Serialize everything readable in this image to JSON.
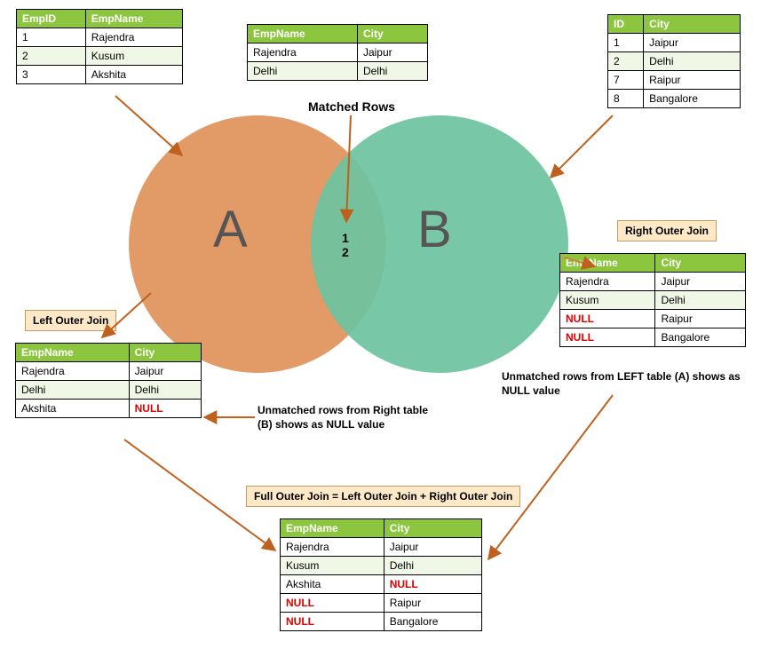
{
  "vennLabels": {
    "a": "A",
    "b": "B",
    "intersect": [
      "1",
      "2"
    ]
  },
  "labels": {
    "matched": "Matched Rows",
    "leftBadge": "Left Outer Join",
    "rightBadge": "Right Outer Join",
    "fullBadge": "Full Outer Join = Left Outer Join + Right Outer Join",
    "capLeft": "Unmatched rows from Right table (B) shows as NULL value",
    "capRight": "Unmatched rows from LEFT table (A) shows as NULL value"
  },
  "tableA": {
    "headers": [
      "EmpID",
      "EmpName"
    ],
    "rows": [
      {
        "c0": "1",
        "c1": "Rajendra",
        "alt": false
      },
      {
        "c0": "2",
        "c1": "Kusum",
        "alt": true
      },
      {
        "c0": "3",
        "c1": "Akshita",
        "alt": false
      }
    ]
  },
  "tableB": {
    "headers": [
      "ID",
      "City"
    ],
    "rows": [
      {
        "c0": "1",
        "c1": "Jaipur",
        "alt": false
      },
      {
        "c0": "2",
        "c1": "Delhi",
        "alt": true
      },
      {
        "c0": "7",
        "c1": "Raipur",
        "alt": false
      },
      {
        "c0": "8",
        "c1": "Bangalore",
        "alt": false
      }
    ]
  },
  "tableMatched": {
    "headers": [
      "EmpName",
      "City"
    ],
    "rows": [
      {
        "c0": "Rajendra",
        "c1": "Jaipur",
        "alt": false
      },
      {
        "c0": "Delhi",
        "c1": "Delhi",
        "alt": true
      }
    ]
  },
  "tableLeft": {
    "headers": [
      "EmpName",
      "City"
    ],
    "rows": [
      {
        "c0": "Rajendra",
        "c1": "Jaipur",
        "alt": false,
        "null0": false,
        "null1": false
      },
      {
        "c0": "Delhi",
        "c1": "Delhi",
        "alt": true,
        "null0": false,
        "null1": false
      },
      {
        "c0": "Akshita",
        "c1": "NULL",
        "alt": false,
        "null0": false,
        "null1": true
      }
    ]
  },
  "tableRight": {
    "headers": [
      "EmpName",
      "City"
    ],
    "rows": [
      {
        "c0": "Rajendra",
        "c1": "Jaipur",
        "alt": false,
        "null0": false,
        "null1": false
      },
      {
        "c0": "Kusum",
        "c1": "Delhi",
        "alt": true,
        "null0": false,
        "null1": false
      },
      {
        "c0": "NULL",
        "c1": "Raipur",
        "alt": false,
        "null0": true,
        "null1": false
      },
      {
        "c0": "NULL",
        "c1": "Bangalore",
        "alt": false,
        "null0": true,
        "null1": false
      }
    ]
  },
  "tableFull": {
    "headers": [
      "EmpName",
      "City"
    ],
    "rows": [
      {
        "c0": "Rajendra",
        "c1": "Jaipur",
        "alt": false,
        "null0": false,
        "null1": false
      },
      {
        "c0": "Kusum",
        "c1": "Delhi",
        "alt": true,
        "null0": false,
        "null1": false
      },
      {
        "c0": "Akshita",
        "c1": "NULL",
        "alt": false,
        "null0": false,
        "null1": true
      },
      {
        "c0": "NULL",
        "c1": "Raipur",
        "alt": false,
        "null0": true,
        "null1": false
      },
      {
        "c0": "NULL",
        "c1": "Bangalore",
        "alt": false,
        "null0": true,
        "null1": false
      }
    ]
  },
  "chart_data": {
    "type": "venn-join-illustration",
    "sets": [
      "A",
      "B"
    ],
    "intersection_ids": [
      1,
      2
    ],
    "left_table": {
      "name": "A",
      "columns": [
        "EmpID",
        "EmpName"
      ],
      "rows": [
        [
          1,
          "Rajendra"
        ],
        [
          2,
          "Kusum"
        ],
        [
          3,
          "Akshita"
        ]
      ]
    },
    "right_table": {
      "name": "B",
      "columns": [
        "ID",
        "City"
      ],
      "rows": [
        [
          1,
          "Jaipur"
        ],
        [
          2,
          "Delhi"
        ],
        [
          7,
          "Raipur"
        ],
        [
          8,
          "Bangalore"
        ]
      ]
    },
    "inner_join": {
      "columns": [
        "EmpName",
        "City"
      ],
      "rows": [
        [
          "Rajendra",
          "Jaipur"
        ],
        [
          "Delhi",
          "Delhi"
        ]
      ]
    },
    "left_outer_join": {
      "columns": [
        "EmpName",
        "City"
      ],
      "rows": [
        [
          "Rajendra",
          "Jaipur"
        ],
        [
          "Delhi",
          "Delhi"
        ],
        [
          "Akshita",
          null
        ]
      ]
    },
    "right_outer_join": {
      "columns": [
        "EmpName",
        "City"
      ],
      "rows": [
        [
          "Rajendra",
          "Jaipur"
        ],
        [
          "Kusum",
          "Delhi"
        ],
        [
          null,
          "Raipur"
        ],
        [
          null,
          "Bangalore"
        ]
      ]
    },
    "full_outer_join": {
      "columns": [
        "EmpName",
        "City"
      ],
      "rows": [
        [
          "Rajendra",
          "Jaipur"
        ],
        [
          "Kusum",
          "Delhi"
        ],
        [
          "Akshita",
          null
        ],
        [
          null,
          "Raipur"
        ],
        [
          null,
          "Bangalore"
        ]
      ]
    }
  }
}
